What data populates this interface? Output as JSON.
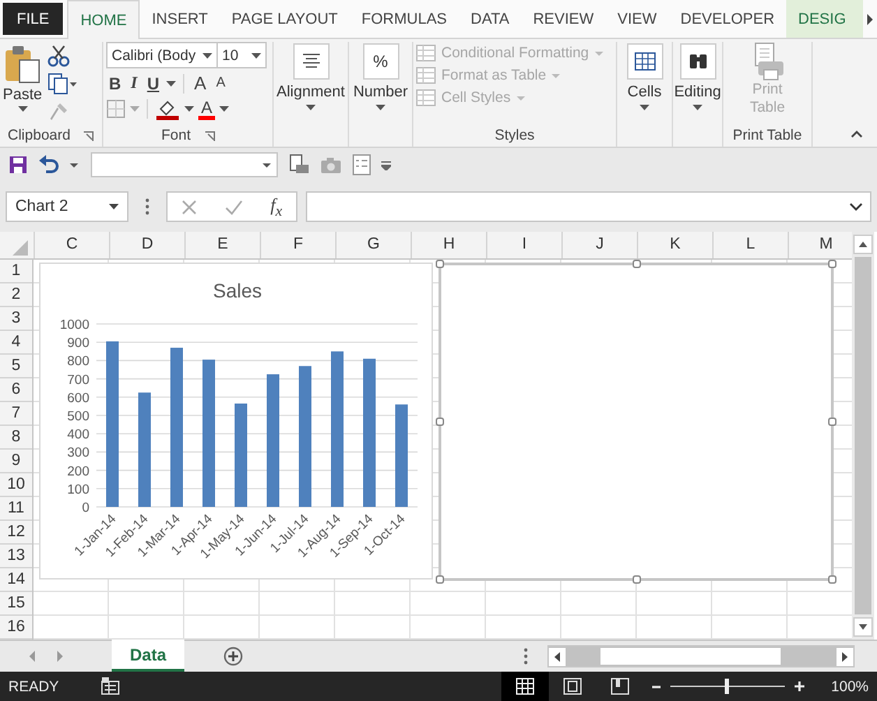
{
  "ribbon_tabs": [
    {
      "label": "FILE",
      "kind": "file",
      "selected": false
    },
    {
      "label": "HOME",
      "kind": "normal",
      "selected": true
    },
    {
      "label": "INSERT",
      "kind": "normal",
      "selected": false
    },
    {
      "label": "PAGE LAYOUT",
      "kind": "normal",
      "selected": false
    },
    {
      "label": "FORMULAS",
      "kind": "normal",
      "selected": false
    },
    {
      "label": "DATA",
      "kind": "normal",
      "selected": false
    },
    {
      "label": "REVIEW",
      "kind": "normal",
      "selected": false
    },
    {
      "label": "VIEW",
      "kind": "normal",
      "selected": false
    },
    {
      "label": "DEVELOPER",
      "kind": "normal",
      "selected": false
    },
    {
      "label": "DESIG",
      "kind": "contextual",
      "selected": false
    }
  ],
  "clipboard": {
    "paste": "Paste",
    "group_label": "Clipboard"
  },
  "font": {
    "name": "Calibri (Body",
    "size": "10",
    "bold": "B",
    "italic": "I",
    "underline": "U",
    "grow": "A",
    "shrink": "A",
    "font_color": "A",
    "group_label": "Font"
  },
  "alignment": {
    "label": "Alignment"
  },
  "number": {
    "symbol": "%",
    "label": "Number"
  },
  "styles": {
    "items": [
      {
        "label": "Conditional Formatting",
        "disabled": true
      },
      {
        "label": "Format as Table",
        "disabled": true
      },
      {
        "label": "Cell Styles",
        "disabled": true
      }
    ],
    "group_label": "Styles"
  },
  "cells": {
    "label": "Cells"
  },
  "editing": {
    "label": "Editing"
  },
  "print_table": {
    "label": "Print Table",
    "disabled": true,
    "group_label": "Print Table"
  },
  "formula_bar": {
    "name_box": "Chart 2",
    "fx": "f$_{x}$"
  },
  "columns": [
    "C",
    "D",
    "E",
    "F",
    "G",
    "H",
    "I",
    "J",
    "K",
    "L",
    "M"
  ],
  "rows": [
    "1",
    "2",
    "3",
    "4",
    "5",
    "6",
    "7",
    "8",
    "9",
    "10",
    "11",
    "12",
    "13",
    "14",
    "15",
    "16"
  ],
  "sales_chart": {
    "chart_data": {
      "type": "bar",
      "title": "Sales",
      "categories": [
        "1-Jan-14",
        "1-Feb-14",
        "1-Mar-14",
        "1-Apr-14",
        "1-May-14",
        "1-Jun-14",
        "1-Jul-14",
        "1-Aug-14",
        "1-Sep-14",
        "1-Oct-14"
      ],
      "series": [
        {
          "color": "#4f81bd",
          "values": [
            905,
            625,
            870,
            805,
            565,
            725,
            770,
            850,
            810,
            560
          ]
        }
      ],
      "grid": true,
      "ylim": [
        0,
        1000
      ],
      "yticks": [
        0,
        100,
        200,
        300,
        400,
        500,
        600,
        700,
        800,
        900,
        1000
      ]
    }
  },
  "empty_chart": {
    "selected": true
  },
  "sheet_tabs": [
    {
      "label": "Data",
      "selected": true
    }
  ],
  "status_bar": {
    "mode": "READY",
    "views": [
      {
        "kind": "normal",
        "selected": true
      },
      {
        "kind": "page_layout",
        "selected": false
      },
      {
        "kind": "page_break",
        "selected": false
      }
    ],
    "zoom_slider": {
      "level": 0.48
    },
    "zoom": "100%"
  }
}
